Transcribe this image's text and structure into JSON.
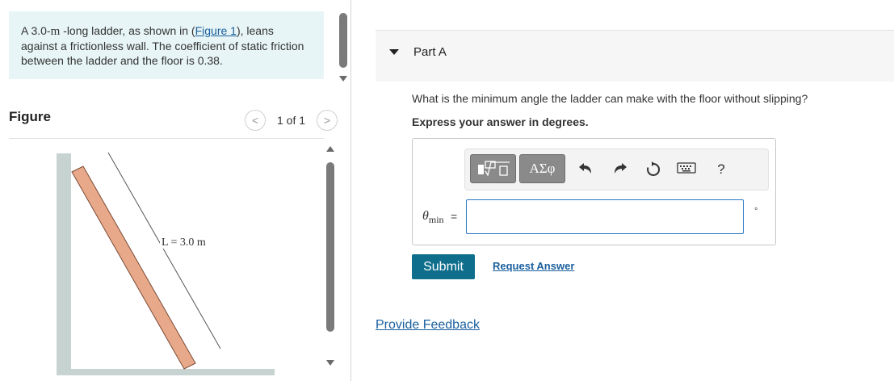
{
  "problem": {
    "text_before": "A 3.0-",
    "unit": "m",
    "text_mid": " -long ladder, as shown in (",
    "figure_link": "Figure 1",
    "text_after": "), leans against a frictionless wall. The coefficient of static friction between the ladder and the floor is 0.38."
  },
  "figure_panel": {
    "title": "Figure",
    "page_counter": "1 of 1",
    "prev_icon": "chevron-left-icon",
    "next_icon": "chevron-right-icon",
    "length_label": "L = 3.0 m"
  },
  "colors": {
    "ladder": "#e8a98a",
    "ladder_stroke": "#7a4a36",
    "wall": "#c7d3d1",
    "submit": "#0e6e8c",
    "link": "#1a5f9e",
    "panel_bg": "#e8f5f6"
  },
  "part": {
    "title": "Part A",
    "question": "What is the minimum angle the ladder can make with the floor without slipping?",
    "instruction": "Express your answer in degrees."
  },
  "toolbar": {
    "templates_icon": "templates-icon",
    "greek_label": "ΑΣφ",
    "undo_icon": "undo-icon",
    "redo_icon": "redo-icon",
    "reset_icon": "reset-icon",
    "keyboard_icon": "keyboard-icon",
    "help_label": "?"
  },
  "answer": {
    "symbol": "θ",
    "subscript": "min",
    "equals": "=",
    "value": "",
    "unit": "°"
  },
  "actions": {
    "submit_label": "Submit",
    "request_answer_label": "Request Answer",
    "feedback_label": "Provide Feedback"
  }
}
